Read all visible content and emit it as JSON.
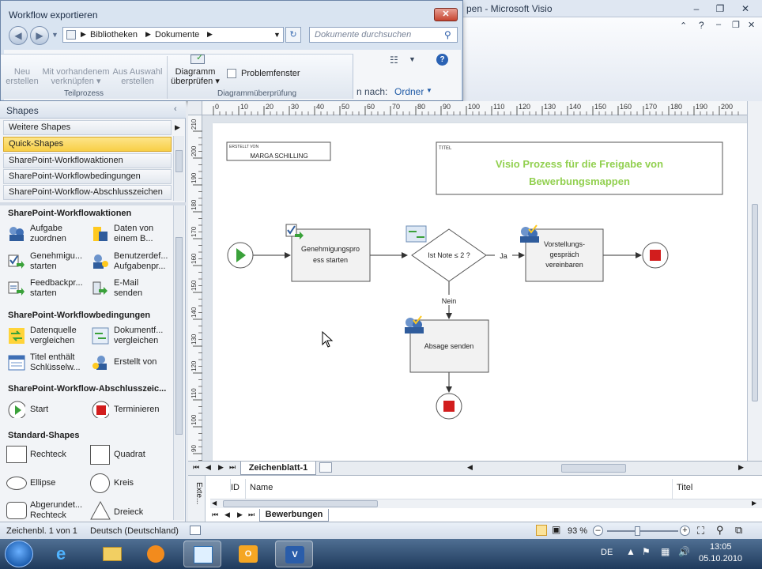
{
  "visio_window": {
    "title": "pen  -  Microsoft Visio",
    "ribbon_search_prefix": "n nach:",
    "ribbon_search_value": "Ordner"
  },
  "dialog": {
    "title": "Workflow exportieren",
    "breadcrumb": [
      "Bibliotheken",
      "Dokumente"
    ],
    "search_placeholder": "Dokumente durchsuchen",
    "ribbon": {
      "neu": [
        "Neu",
        "erstellen"
      ],
      "mit": [
        "Mit vorhandenem",
        "verknüpfen"
      ],
      "aus": [
        "Aus Auswahl",
        "erstellen"
      ],
      "diagramm": [
        "Diagramm",
        "überprüfen"
      ],
      "problemfenster": "Problemfenster",
      "group_teilprozess": "Teilprozess",
      "group_diagramm": "Diagrammüberprüfung"
    }
  },
  "shapes_panel": {
    "title": "Shapes",
    "stencils": [
      "Weitere Shapes",
      "Quick-Shapes",
      "SharePoint-Workflowaktionen",
      "SharePoint-Workflowbedingungen",
      "SharePoint-Workflow-Abschlusszeichen"
    ],
    "sections": [
      {
        "title": "SharePoint-Workflowaktionen",
        "items": [
          [
            "Aufgabe",
            "zuordnen"
          ],
          [
            "Daten von",
            "einem B..."
          ],
          [
            "Genehmigu...",
            "starten"
          ],
          [
            "Benutzerdef...",
            "Aufgabenpr..."
          ],
          [
            "Feedbackpr...",
            "starten"
          ],
          [
            "E-Mail",
            "senden"
          ]
        ]
      },
      {
        "title": "SharePoint-Workflowbedingungen",
        "items": [
          [
            "Datenquelle",
            "vergleichen"
          ],
          [
            "Dokumentf...",
            "vergleichen"
          ],
          [
            "Titel enthält",
            "Schlüsselw..."
          ],
          [
            "Erstellt von",
            ""
          ]
        ]
      },
      {
        "title": "SharePoint-Workflow-Abschlusszeic...",
        "items": [
          [
            "Start",
            ""
          ],
          [
            "Terminieren",
            ""
          ]
        ]
      },
      {
        "title": "Standard-Shapes",
        "items": [
          [
            "Rechteck",
            ""
          ],
          [
            "Quadrat",
            ""
          ],
          [
            "Ellipse",
            ""
          ],
          [
            "Kreis",
            ""
          ],
          [
            "Abgerundet...",
            "Rechteck"
          ],
          [
            "Dreieck",
            ""
          ]
        ]
      }
    ]
  },
  "ruler": {
    "h_ticks": [
      "0",
      "10",
      "20",
      "30",
      "40",
      "50",
      "60",
      "70",
      "80",
      "90",
      "100",
      "110",
      "120",
      "130",
      "140",
      "150",
      "160",
      "170",
      "180",
      "190",
      "200"
    ],
    "v_ticks": [
      "210",
      "200",
      "190",
      "180",
      "170",
      "160",
      "150",
      "140",
      "130",
      "120",
      "110",
      "100",
      "90"
    ]
  },
  "diagram": {
    "created_by_label": "ERSTELLT VON",
    "created_by_value": "MARGA SCHILLING",
    "title_label": "TITEL",
    "title_lines": [
      "Visio Prozess für die Freigabe von",
      "Bewerbungsmappen"
    ],
    "title_color": "#92d050",
    "approval_lines": [
      "Genehmigungspro",
      "ess starten"
    ],
    "decision": "Ist Note ≤ 2 ?",
    "yes": "Ja",
    "no": "Nein",
    "interview_lines": [
      "Vorstellungs-",
      "gespräch",
      "vereinbaren"
    ],
    "reject": "Absage senden"
  },
  "sheet_tab": "Zeichenblatt-1",
  "external_data": {
    "side_label": "Exte...",
    "columns": [
      "ID",
      "Name",
      "Titel"
    ],
    "tab": "Bewerbungen"
  },
  "status": {
    "page": "Zeichenbl. 1 von 1",
    "language": "Deutsch (Deutschland)",
    "zoom": "93 %"
  },
  "tray": {
    "lang": "DE",
    "time": "13:05",
    "date": "05.10.2010"
  }
}
